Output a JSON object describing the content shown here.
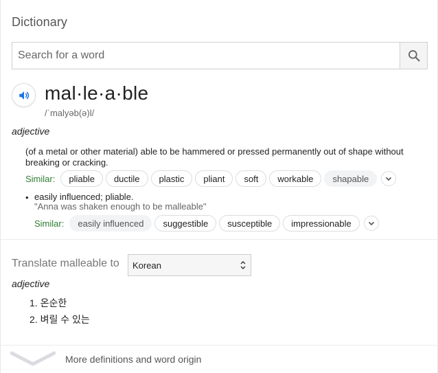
{
  "card": {
    "title": "Dictionary"
  },
  "search": {
    "placeholder": "Search for a word",
    "value": ""
  },
  "entry": {
    "headword": "mal·le·a·ble",
    "pronunciation": "/ˈmalyəb(ə)l/",
    "part_of_speech": "adjective",
    "definitions": [
      {
        "text": "(of a metal or other material) able to be hammered or pressed permanently out of shape without breaking or cracking.",
        "similar_label": "Similar:",
        "similar": [
          "pliable",
          "ductile",
          "plastic",
          "pliant",
          "soft",
          "workable",
          "shapable"
        ]
      },
      {
        "text": "easily influenced; pliable.",
        "example": "\"Anna was shaken enough to be malleable\"",
        "similar_label": "Similar:",
        "similar": [
          "easily influenced",
          "suggestible",
          "susceptible",
          "impressionable"
        ]
      }
    ]
  },
  "translate": {
    "label": "Translate malleable to",
    "language": "Korean",
    "part_of_speech": "adjective",
    "items": [
      "1. 온순한",
      "2. 벼릴 수 있는"
    ]
  },
  "footer": {
    "more_label": "More definitions and word origin"
  },
  "icons": {
    "search": "search-icon",
    "speaker": "speaker-icon",
    "expand": "chevron-down-icon",
    "select": "select-arrows-icon"
  },
  "colors": {
    "similar_label": "#2e7d32",
    "speaker_accent": "#1a73e8"
  }
}
